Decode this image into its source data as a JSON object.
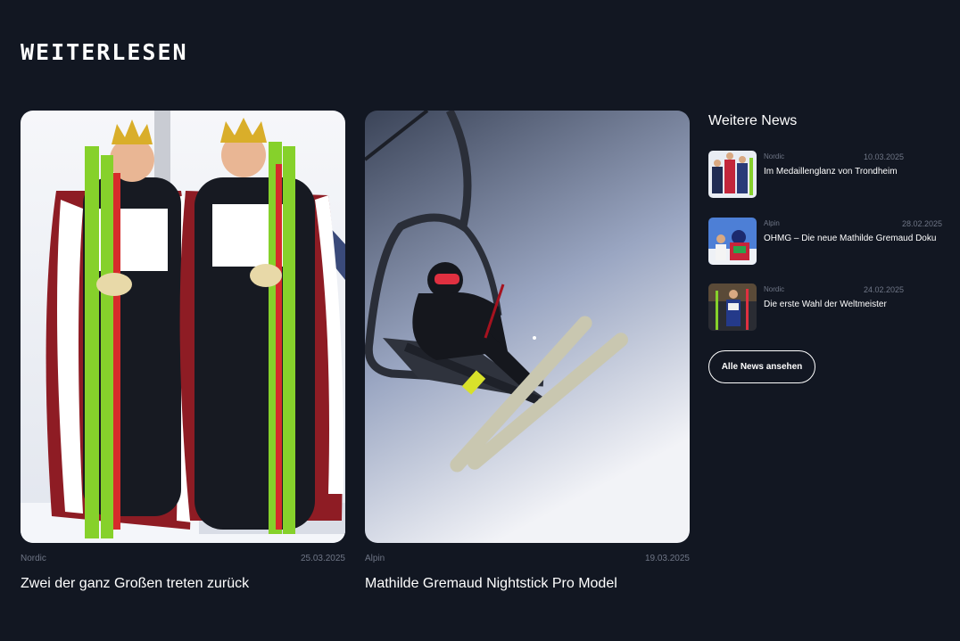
{
  "section": {
    "title": "WEITERLESEN"
  },
  "cards": [
    {
      "category": "Nordic",
      "date": "25.03.2025",
      "title": "Zwei der ganz Großen treten zurück"
    },
    {
      "category": "Alpin",
      "date": "19.03.2025",
      "title": "Mathilde Gremaud Nightstick Pro Model"
    }
  ],
  "sidebar": {
    "title": "Weitere News",
    "items": [
      {
        "category": "Nordic",
        "date": "10.03.2025",
        "title": "Im Medaillenglanz von Trondheim"
      },
      {
        "category": "Alpin",
        "date": "28.02.2025",
        "title": "OHMG – Die neue Mathilde Gremaud Doku"
      },
      {
        "category": "Nordic",
        "date": "24.02.2025",
        "title": "Die erste Wahl der Weltmeister"
      }
    ],
    "button_label": "Alle News ansehen"
  },
  "colors": {
    "background": "#121722",
    "text": "#ffffff",
    "muted": "#6f7686"
  }
}
